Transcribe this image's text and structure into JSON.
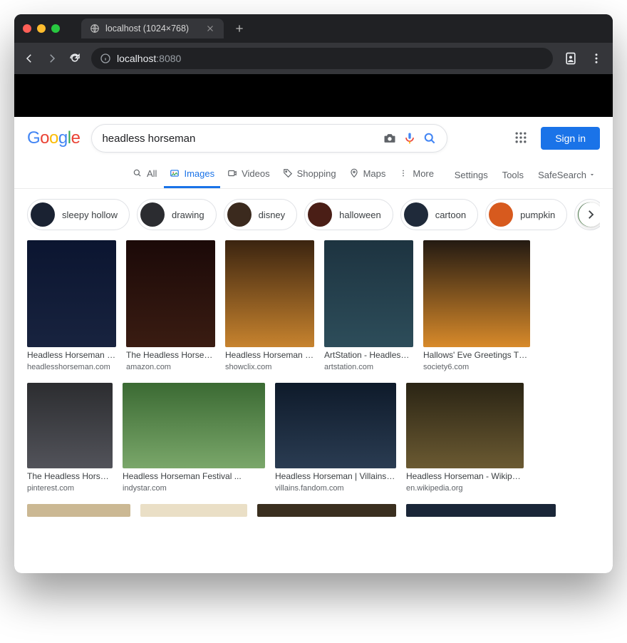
{
  "browser": {
    "tab_title": "localhost (1024×768)",
    "url_info": "ⓘ",
    "url_host": "localhost",
    "url_port": ":8080"
  },
  "header": {
    "logo_letters": [
      "G",
      "o",
      "o",
      "g",
      "l",
      "e"
    ],
    "search_value": "headless horseman",
    "sign_in": "Sign in"
  },
  "tabs": {
    "all": "All",
    "images": "Images",
    "videos": "Videos",
    "shopping": "Shopping",
    "maps": "Maps",
    "more": "More",
    "settings": "Settings",
    "tools": "Tools",
    "safesearch": "SafeSearch"
  },
  "chips": [
    {
      "label": "sleepy hollow",
      "bg": "#1a2232"
    },
    {
      "label": "drawing",
      "bg": "#2b2c30"
    },
    {
      "label": "disney",
      "bg": "#3b2a1e"
    },
    {
      "label": "halloween",
      "bg": "#4a1e16"
    },
    {
      "label": "cartoon",
      "bg": "#1f2a3a"
    },
    {
      "label": "pumpkin",
      "bg": "#d75a1e"
    }
  ],
  "row1": [
    {
      "title": "Headless Horseman Hayri...",
      "domain": "headlesshorseman.com",
      "bg": "linear-gradient(#0b1530,#18233f)",
      "w": "r1"
    },
    {
      "title": "The Headless Horseman o...",
      "domain": "amazon.com",
      "bg": "linear-gradient(#1b0908,#3a1c12)",
      "w": "r1"
    },
    {
      "title": "Headless Horseman with H...",
      "domain": "showclix.com",
      "bg": "linear-gradient(#3b2410,#c7832e)",
      "w": "r1"
    },
    {
      "title": "ArtStation - Headless hors...",
      "domain": "artstation.com",
      "bg": "linear-gradient(#1d3340,#2d4d5a)",
      "w": "r1"
    },
    {
      "title": "Hallows' Eve Greetings Throw Blank...",
      "domain": "society6.com",
      "bg": "linear-gradient(#231a12,#d88a2a)",
      "w": "r1w"
    }
  ],
  "row2": [
    {
      "title": "The Headless Horsema...",
      "domain": "pinterest.com",
      "bg": "linear-gradient(#2c2d30,#52535a)",
      "cls": "r2a"
    },
    {
      "title": "Headless Horseman Festival ...",
      "domain": "indystar.com",
      "bg": "linear-gradient(#3b6a33,#7aa76a)",
      "cls": "r2b"
    },
    {
      "title": "Headless Horseman | Villains Wiki ...",
      "domain": "villains.fandom.com",
      "bg": "linear-gradient(#0e1a2a,#2a3c52)",
      "cls": "r2c"
    },
    {
      "title": "Headless Horseman - Wikipedia",
      "domain": "en.wikipedia.org",
      "bg": "linear-gradient(#2a2414,#6b5a32)",
      "cls": "r2d"
    }
  ]
}
